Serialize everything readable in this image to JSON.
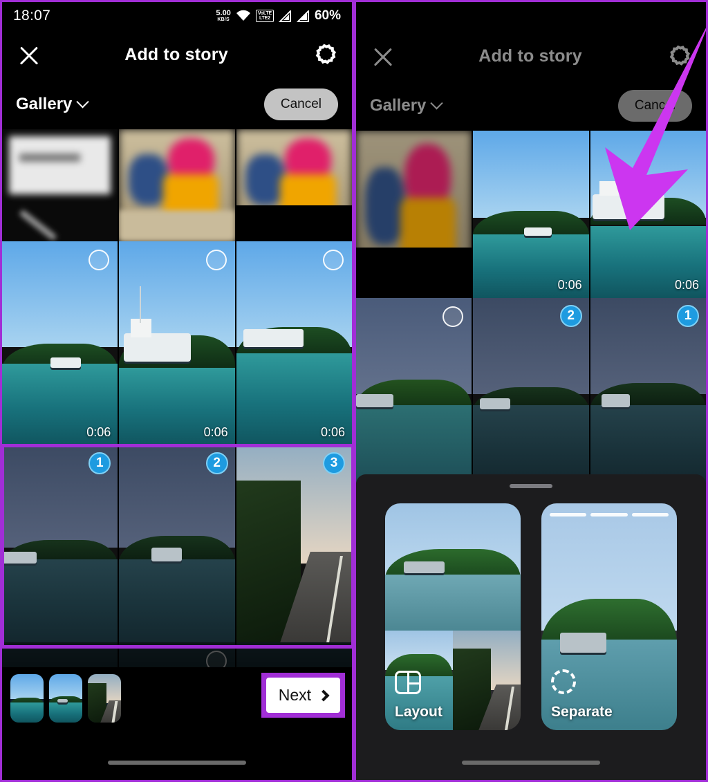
{
  "left_panel": {
    "statusbar": {
      "time": "18:07",
      "net_speed_value": "5.00",
      "net_speed_unit": "KB/S",
      "wifi_icon": "wifi-icon",
      "volte_line1": "VoLTE",
      "volte_line2": "LTE2",
      "signal_icon_1": "signal-bars-icon",
      "signal_icon_2": "signal-bars-icon",
      "battery_percent": "60%"
    },
    "header": {
      "close_icon": "close-x-icon",
      "title": "Add to story",
      "settings_icon": "gear-icon"
    },
    "gallerybar": {
      "source_label": "Gallery",
      "chevron_icon": "chevron-down-icon",
      "cancel_label": "Cancel"
    },
    "grid": {
      "row1": [
        {
          "kind": "document-blur",
          "selected": false,
          "badge": "",
          "duration": ""
        },
        {
          "kind": "person-blur",
          "selected": false,
          "badge": "",
          "duration": ""
        },
        {
          "kind": "person-blur",
          "selected": false,
          "badge": "",
          "duration": ""
        }
      ],
      "row2": [
        {
          "kind": "boat-water",
          "selected": false,
          "badge": "",
          "duration": "0:06"
        },
        {
          "kind": "boat-dock",
          "selected": false,
          "badge": "",
          "duration": "0:06"
        },
        {
          "kind": "boat-far",
          "selected": false,
          "badge": "",
          "duration": "0:06"
        }
      ],
      "row3": [
        {
          "kind": "lake-dim",
          "selected": true,
          "badge": "1",
          "duration": ""
        },
        {
          "kind": "boat-dim",
          "selected": true,
          "badge": "2",
          "duration": ""
        },
        {
          "kind": "road-dim",
          "selected": true,
          "badge": "3",
          "duration": ""
        }
      ]
    },
    "bottombar": {
      "selected_thumbs": [
        "lake",
        "boat",
        "road"
      ],
      "next_label": "Next",
      "next_chevron_icon": "chevron-right-icon"
    },
    "annotations": {
      "selection_box_color": "#a12ed6",
      "next_box_color": "#a12ed6"
    }
  },
  "right_panel": {
    "header": {
      "close_icon": "close-x-icon",
      "title": "Add to story",
      "settings_icon": "gear-icon"
    },
    "gallerybar": {
      "source_label": "Gallery",
      "chevron_icon": "chevron-down-icon",
      "cancel_label": "Cancel"
    },
    "grid": {
      "row1": [
        {
          "kind": "person-blur",
          "selected": false,
          "badge": "",
          "duration": ""
        },
        {
          "kind": "boat-water",
          "selected": false,
          "badge": "",
          "duration": "0:06"
        },
        {
          "kind": "boat-dock",
          "selected": false,
          "badge": "",
          "duration": "0:06"
        }
      ],
      "row2": [
        {
          "kind": "lake",
          "selected": false,
          "badge": "",
          "duration": ""
        },
        {
          "kind": "boat-dim",
          "selected": true,
          "badge": "2",
          "duration": ""
        },
        {
          "kind": "boat-dim",
          "selected": true,
          "badge": "1",
          "duration": ""
        }
      ]
    },
    "sheet": {
      "grab_handle": "drag-handle",
      "options": [
        {
          "label": "Layout",
          "icon": "layout-grid-icon"
        },
        {
          "label": "Separate",
          "icon": "separate-circle-icon"
        }
      ]
    },
    "annotations": {
      "arrow_color": "#cc36f0",
      "arrow_points_to": "Separate"
    }
  },
  "colors": {
    "annotation_magenta": "#a12ed6",
    "arrow_magenta": "#cc36f0",
    "badge_blue": "#1e9be0",
    "cancel_grey": "#c3c3c3",
    "sheet_bg": "#1c1c1e"
  }
}
